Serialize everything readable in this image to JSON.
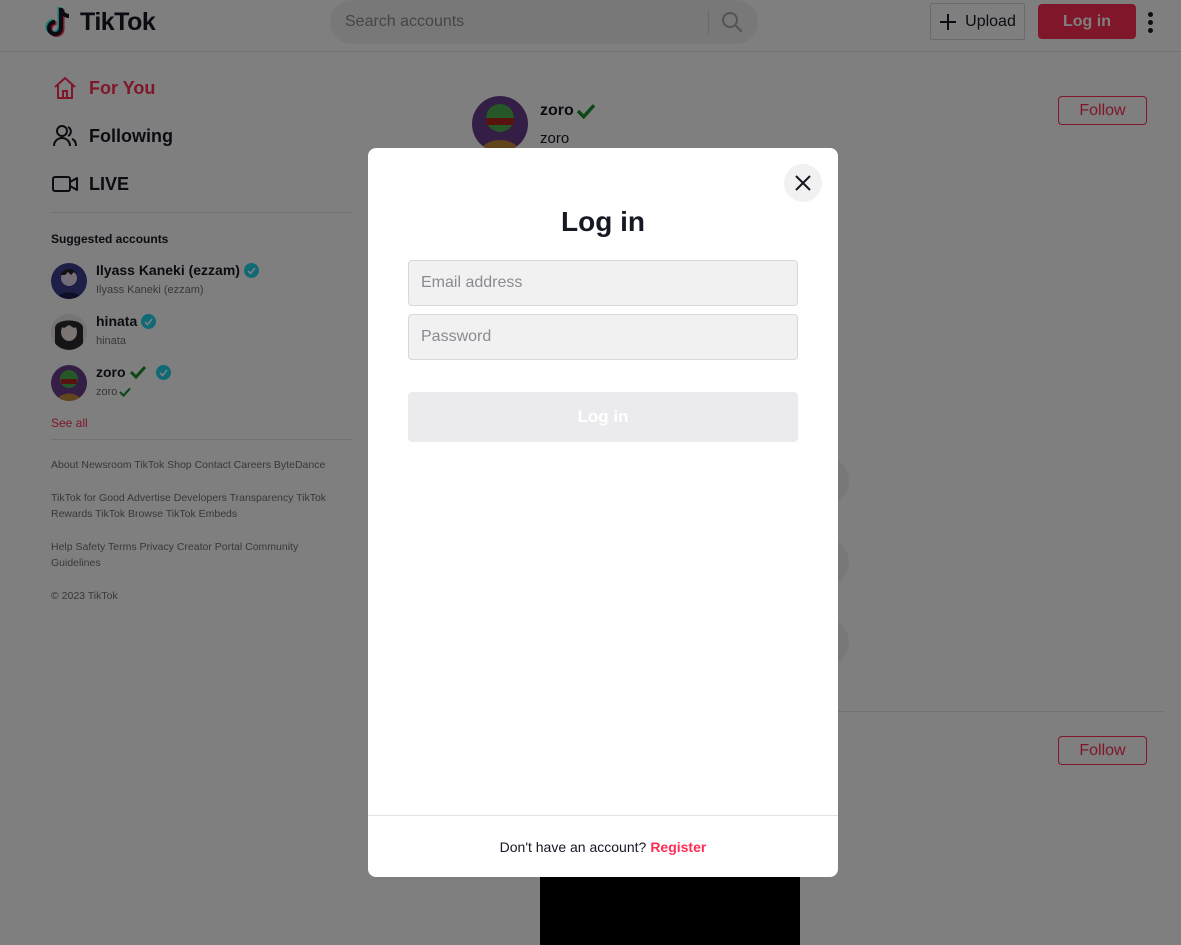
{
  "header": {
    "logo_text": "TikTok",
    "search_placeholder": "Search accounts",
    "upload_label": "Upload",
    "login_label": "Log in"
  },
  "sidebar": {
    "nav": [
      {
        "label": "For You",
        "icon": "home-icon",
        "active": true
      },
      {
        "label": "Following",
        "icon": "users-icon",
        "active": false
      },
      {
        "label": "LIVE",
        "icon": "live-icon",
        "active": false
      }
    ],
    "suggested_title": "Suggested accounts",
    "accounts": [
      {
        "name": "Ilyass Kaneki (ezzam)",
        "handle": "Ilyass Kaneki (ezzam)"
      },
      {
        "name": "hinata",
        "handle": "hinata"
      },
      {
        "name": "zoro",
        "handle": "zoro"
      }
    ],
    "see_all": "See all",
    "footer": [
      "About Newsroom TikTok Shop Contact Careers ByteDance",
      "TikTok for Good Advertise Developers Transparency TikTok Rewards TikTok Browse TikTok Embeds",
      "Help Safety Terms Privacy Creator Portal Community Guidelines",
      "© 2023 TikTok"
    ]
  },
  "feed": {
    "post": {
      "author": "zoro",
      "caption": "zoro"
    },
    "follow_label": "Follow"
  },
  "modal": {
    "title": "Log in",
    "email_placeholder": "Email address",
    "password_placeholder": "Password",
    "submit_label": "Log in",
    "footer_text": "Don't have an account?",
    "register_label": "Register"
  },
  "colors": {
    "brand": "#fe2c55",
    "verified": "#20d5ec",
    "checkmark": "#1a8f2e"
  }
}
